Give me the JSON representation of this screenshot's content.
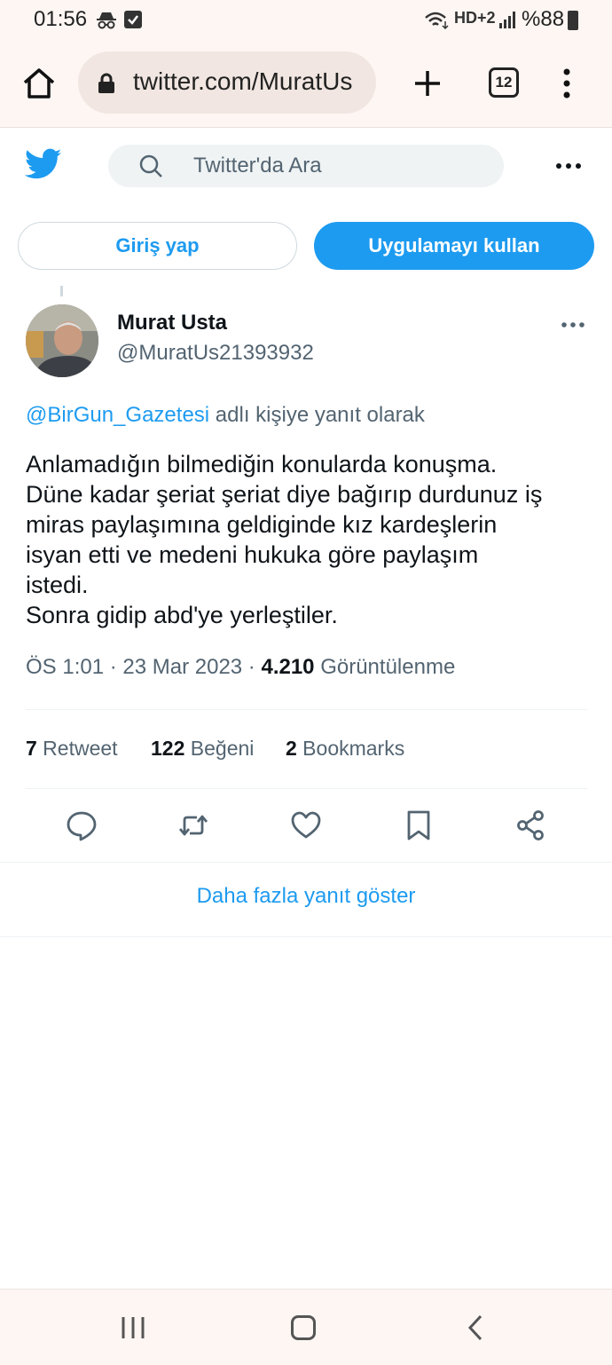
{
  "status_bar": {
    "time": "01:56",
    "hd_label": "HD+2",
    "battery": "%88",
    "icons": [
      "incognito-icon",
      "checkbox-icon",
      "wifi-icon",
      "signal-icon",
      "battery-icon"
    ]
  },
  "browser": {
    "url": "twitter.com/MuratUs",
    "tab_count": "12",
    "icons": [
      "home-icon",
      "lock-icon",
      "plus-icon",
      "tabs-icon",
      "more-vert-icon"
    ]
  },
  "twitter": {
    "search_placeholder": "Twitter'da Ara",
    "login_label": "Giriş yap",
    "app_label": "Uygulamayı kullan",
    "brand_color": "#1d9bf0"
  },
  "tweet": {
    "display_name": "Murat Usta",
    "handle": "@MuratUs21393932",
    "reply_mention": "@BirGun_Gazetesi",
    "reply_suffix": " adlı kişiye yanıt olarak",
    "text_lines": [
      "Anlamadığın bilmediğin konularda konuşma.",
      "Düne kadar şeriat şeriat diye bağırıp durdunuz iş",
      "miras paylaşımına geldiginde kız kardeşlerin",
      "isyan etti ve medeni hukuka göre paylaşım",
      "istedi.",
      "Sonra gidip abd'ye yerleştiler."
    ],
    "time": "ÖS 1:01 · 23 Mar 2023 · ",
    "views_count": "4.210",
    "views_label": " Görüntülenme",
    "stats": {
      "retweets": "7",
      "retweets_label": " Retweet",
      "likes": "122",
      "likes_label": " Beğeni",
      "bookmarks": "2",
      "bookmarks_label": " Bookmarks"
    },
    "actions": [
      "reply-icon",
      "retweet-icon",
      "like-icon",
      "bookmark-icon",
      "share-icon"
    ]
  },
  "more_replies": "Daha fazla yanıt göster"
}
